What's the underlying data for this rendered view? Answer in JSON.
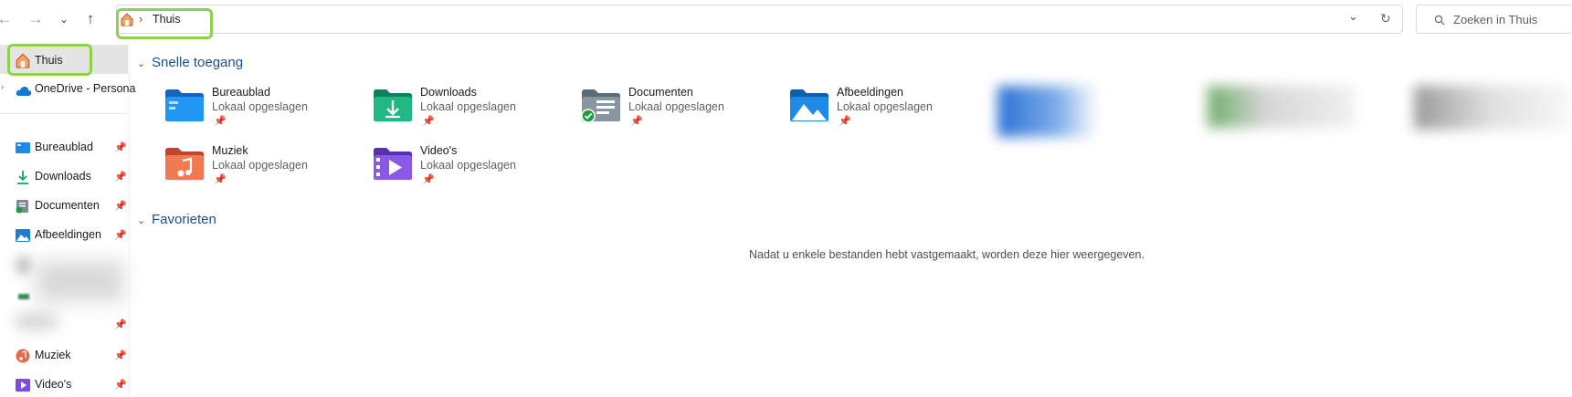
{
  "toolbar": {
    "back_icon": "arrow-left-icon",
    "forward_icon": "arrow-right-icon",
    "recent_icon": "chevron-down-icon",
    "up_icon": "arrow-up-icon"
  },
  "address": {
    "separator": "›",
    "location": "Thuis",
    "dropdown_icon": "chevron-down-icon",
    "refresh_icon": "refresh-icon"
  },
  "search": {
    "placeholder": "Zoeken in Thuis"
  },
  "sidebar": {
    "home": "Thuis",
    "onedrive": "OneDrive - Persona",
    "items": [
      {
        "label": "Bureaublad",
        "icon": "desktop-folder-icon"
      },
      {
        "label": "Downloads",
        "icon": "download-icon"
      },
      {
        "label": "Documenten",
        "icon": "document-folder-icon"
      },
      {
        "label": "Afbeeldingen",
        "icon": "pictures-folder-icon"
      },
      {
        "label": "Muziek",
        "icon": "music-folder-icon"
      },
      {
        "label": "Video's",
        "icon": "video-folder-icon"
      }
    ]
  },
  "quick_access": {
    "title": "Snelle toegang",
    "tiles": [
      {
        "name": "Bureaublad",
        "status": "Lokaal opgeslagen"
      },
      {
        "name": "Downloads",
        "status": "Lokaal opgeslagen"
      },
      {
        "name": "Documenten",
        "status": "Lokaal opgeslagen"
      },
      {
        "name": "Afbeeldingen",
        "status": "Lokaal opgeslagen"
      },
      {
        "name": "Muziek",
        "status": "Lokaal opgeslagen"
      },
      {
        "name": "Video's",
        "status": "Lokaal opgeslagen"
      }
    ]
  },
  "favorites": {
    "title": "Favorieten",
    "empty_message": "Nadat u enkele bestanden hebt vastgemaakt, worden deze hier weergegeven."
  },
  "colors": {
    "highlight": "#8fd14f",
    "section_title": "#1b4f93",
    "selection": "#e5e5e5"
  }
}
